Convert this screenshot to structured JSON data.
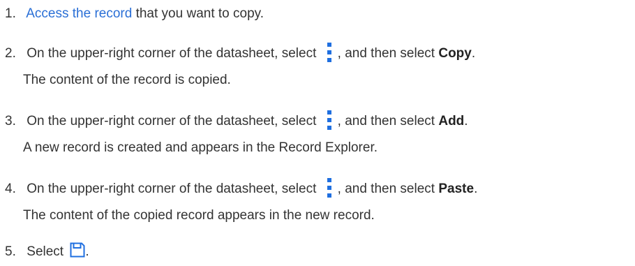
{
  "steps": [
    {
      "number": "1.",
      "link": "Access the record",
      "text_after": " that you want to copy."
    },
    {
      "number": "2.",
      "text_before": "On the upper-right corner of the datasheet, select",
      "text_mid": ", and then select ",
      "bold": "Copy",
      "text_end": ".",
      "result": "The content of the record is copied."
    },
    {
      "number": "3.",
      "text_before": "On the upper-right corner of the datasheet, select",
      "text_mid": ", and then select ",
      "bold": "Add",
      "text_end": ".",
      "result": "A new record is created and appears in the Record Explorer."
    },
    {
      "number": "4.",
      "text_before": "On the upper-right corner of the datasheet, select",
      "text_mid": ", and then select ",
      "bold": "Paste",
      "text_end": ".",
      "result": "The content of the copied record appears in the new record."
    },
    {
      "number": "5.",
      "text_before": "Select",
      "text_end": "."
    }
  ],
  "icons": {
    "more": "more-options-icon",
    "save": "save-icon"
  },
  "colors": {
    "link": "#2a6fd6",
    "icon": "#1f6fe0",
    "text": "#333333"
  }
}
